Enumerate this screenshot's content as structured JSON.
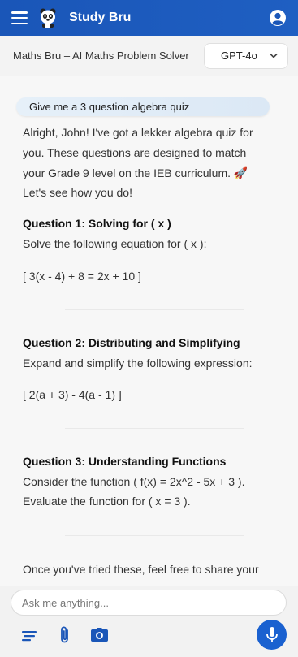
{
  "app": {
    "title": "Study Bru"
  },
  "subheader": {
    "title": "Maths Bru – AI Maths Problem Solver",
    "model_selected": "GPT-4o"
  },
  "chat": {
    "user_message": "Give me a 3 question algebra quiz",
    "intro_lines": [
      "Alright, John! I've got a lekker algebra quiz for",
      "you. These questions are designed to match",
      "your Grade 9 level on the IEB curriculum. 🚀",
      "Let's see how you do!"
    ],
    "questions": [
      {
        "heading": "Question 1: Solving for ( x )",
        "text": "Solve the following equation for ( x ):",
        "math": "[ 3(x - 4) + 8 = 2x + 10 ]"
      },
      {
        "heading": "Question 2: Distributing and Simplifying",
        "text": "Expand and simplify the following expression:",
        "math": "[ 2(a + 3) - 4(a - 1) ]"
      },
      {
        "heading": "Question 3: Understanding Functions",
        "line1": "Consider the function ( f(x) = 2x^2 - 5x + 3 ).",
        "line2": "Evaluate the function for ( x = 3 )."
      }
    ],
    "outro_line": "Once you've tried these, feel free to share your"
  },
  "composer": {
    "placeholder": "Ask me anything..."
  },
  "icons": [
    "menu-icon",
    "mascot-logo",
    "account-icon",
    "chevron-down-icon",
    "notes-icon",
    "paperclip-icon",
    "camera-icon",
    "microphone-icon"
  ],
  "colors": {
    "brand_blue": "#1a56b8",
    "mic_blue": "#1a61d0",
    "bubble": "#e3eef8"
  }
}
